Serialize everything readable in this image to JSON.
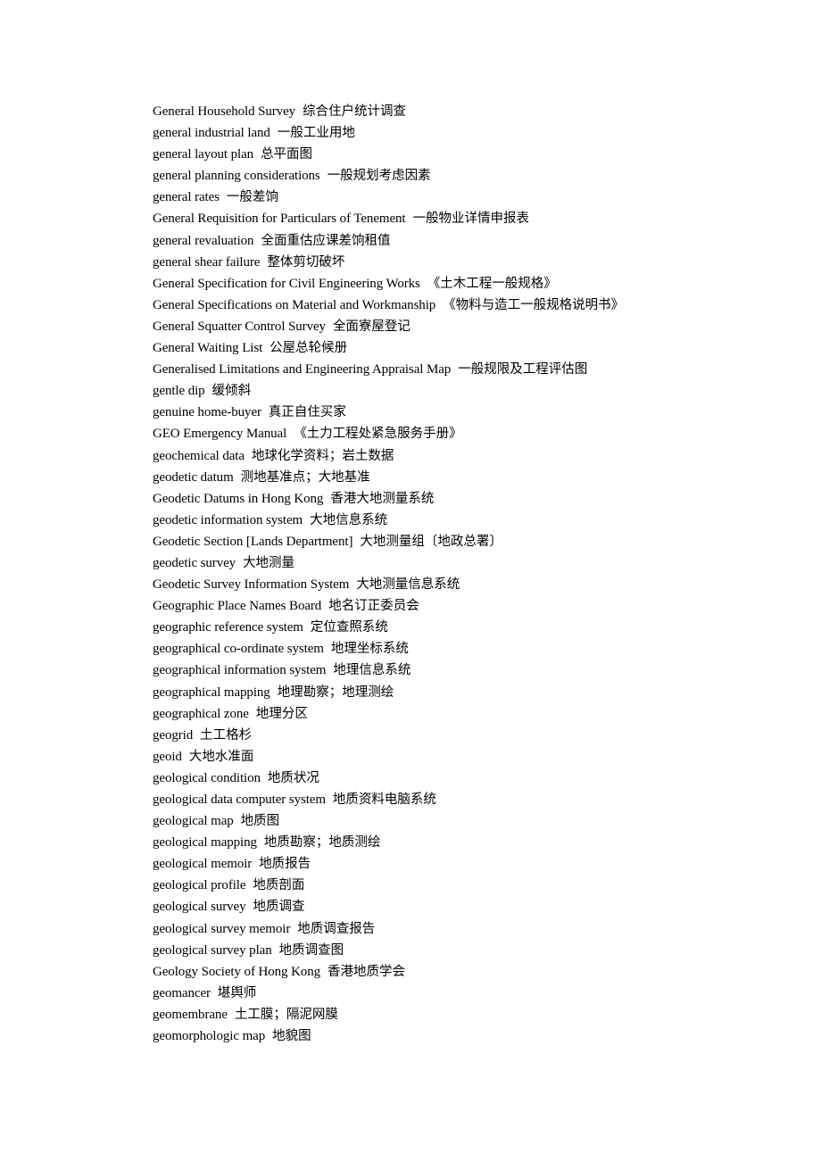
{
  "document": {
    "entries": [
      {
        "en": "General Household Survey",
        "zh": "综合住户统计调查"
      },
      {
        "en": "general industrial land",
        "zh": "一般工业用地"
      },
      {
        "en": "general layout plan",
        "zh": "总平面图"
      },
      {
        "en": "general planning considerations",
        "zh": "一般规划考虑因素"
      },
      {
        "en": "general rates",
        "zh": "一般差饷"
      },
      {
        "en": "General Requisition for Particulars of Tenement",
        "zh": "一般物业详情申报表"
      },
      {
        "en": "general revaluation",
        "zh": "全面重估应课差饷租值"
      },
      {
        "en": "general shear failure",
        "zh": "整体剪切破坏"
      },
      {
        "en": "General Specification for Civil Engineering Works",
        "zh": "《土木工程一般规格》"
      },
      {
        "en": "General Specifications on Material and Workmanship",
        "zh": "《物料与造工一般规格说明书》"
      },
      {
        "en": "General Squatter Control Survey",
        "zh": "全面寮屋登记"
      },
      {
        "en": "General Waiting List",
        "zh": "公屋总轮候册"
      },
      {
        "en": "Generalised Limitations and Engineering Appraisal Map",
        "zh": "一般规限及工程评估图"
      },
      {
        "en": "gentle dip",
        "zh": "缓倾斜"
      },
      {
        "en": "genuine home-buyer",
        "zh": "真正自住买家"
      },
      {
        "en": "GEO Emergency Manual",
        "zh": "《土力工程处紧急服务手册》"
      },
      {
        "en": "geochemical data",
        "zh": "地球化学资料；岩土数据"
      },
      {
        "en": "geodetic datum",
        "zh": "测地基准点；大地基准"
      },
      {
        "en": "Geodetic Datums in Hong Kong",
        "zh": "香港大地测量系统"
      },
      {
        "en": "geodetic information system",
        "zh": "大地信息系统"
      },
      {
        "en": "Geodetic Section [Lands Department]",
        "zh": "大地测量组〔地政总署〕"
      },
      {
        "en": "geodetic survey",
        "zh": "大地测量"
      },
      {
        "en": "Geodetic Survey Information System",
        "zh": "大地测量信息系统"
      },
      {
        "en": "Geographic Place Names Board",
        "zh": "地名订正委员会"
      },
      {
        "en": "geographic reference system",
        "zh": "定位查照系统"
      },
      {
        "en": "geographical co-ordinate system",
        "zh": "地理坐标系统"
      },
      {
        "en": "geographical information system",
        "zh": "地理信息系统"
      },
      {
        "en": "geographical mapping",
        "zh": "地理勘察；地理测绘"
      },
      {
        "en": "geographical zone",
        "zh": "地理分区"
      },
      {
        "en": "geogrid",
        "zh": "土工格杉"
      },
      {
        "en": "geoid",
        "zh": "大地水准面"
      },
      {
        "en": "geological condition",
        "zh": "地质状况"
      },
      {
        "en": "geological data computer system",
        "zh": "地质资料电脑系统"
      },
      {
        "en": "geological map",
        "zh": "地质图"
      },
      {
        "en": "geological mapping",
        "zh": "地质勘察；地质测绘"
      },
      {
        "en": "geological memoir",
        "zh": "地质报告"
      },
      {
        "en": "geological profile",
        "zh": "地质剖面"
      },
      {
        "en": "geological survey",
        "zh": "地质调查"
      },
      {
        "en": "geological survey memoir",
        "zh": "地质调查报告"
      },
      {
        "en": "geological survey plan",
        "zh": "地质调查图"
      },
      {
        "en": "Geology Society of Hong Kong",
        "zh": "香港地质学会"
      },
      {
        "en": "geomancer",
        "zh": "堪舆师"
      },
      {
        "en": "geomembrane",
        "zh": "土工膜；隔泥网膜"
      },
      {
        "en": "geomorphologic map",
        "zh": "地貌图"
      }
    ]
  }
}
